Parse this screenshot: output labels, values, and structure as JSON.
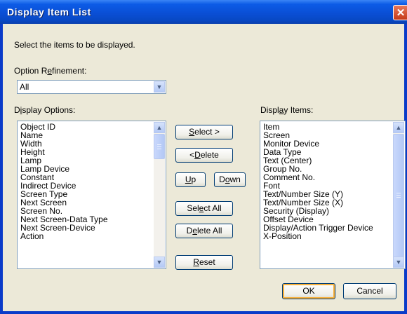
{
  "window": {
    "title": "Display Item List",
    "close_glyph": "✕"
  },
  "instructions": "Select the items to be displayed.",
  "option_refinement": {
    "label_pre": "Option R",
    "label_ul": "e",
    "label_post": "finement:",
    "value": "All"
  },
  "display_options": {
    "label_pre": "D",
    "label_ul": "i",
    "label_post": "splay Options:",
    "items": [
      "Object ID",
      "Name",
      "Width",
      "Height",
      "Lamp",
      "Lamp Device",
      "Constant",
      "Indirect Device",
      "Screen Type",
      "Next Screen",
      "Screen No.",
      "Next Screen-Data Type",
      "Next Screen-Device",
      "Action"
    ]
  },
  "display_items": {
    "label_pre": "Displ",
    "label_ul": "a",
    "label_post": "y Items:",
    "items": [
      "Item",
      "Screen",
      "Monitor Device",
      "Data Type",
      "Text (Center)",
      "Group No.",
      "Comment No.",
      "Font",
      "Text/Number Size (Y)",
      "Text/Number Size (X)",
      "Security (Display)",
      "Offset Device",
      "Display/Action Trigger Device",
      "X-Position"
    ]
  },
  "buttons": {
    "select": {
      "pre": "",
      "ul": "S",
      "post": "elect >"
    },
    "delete": {
      "pre": "< ",
      "ul": "D",
      "post": "elete"
    },
    "up": {
      "pre": "",
      "ul": "U",
      "post": "p"
    },
    "down": {
      "pre": "D",
      "ul": "o",
      "post": "wn"
    },
    "select_all": {
      "pre": "Sel",
      "ul": "e",
      "post": "ct All"
    },
    "delete_all": {
      "pre": "D",
      "ul": "e",
      "post": "lete All"
    },
    "reset": {
      "pre": "",
      "ul": "R",
      "post": "eset"
    },
    "ok": {
      "pre": "OK",
      "ul": "",
      "post": ""
    },
    "cancel": {
      "pre": "Cancel",
      "ul": "",
      "post": ""
    }
  },
  "icons": {
    "combo_arrow": "chevron-down-icon",
    "scroll_up": "chevron-up-icon",
    "scroll_down": "chevron-down-icon"
  },
  "colors": {
    "titlebar": "#0a4fd6",
    "dialog_bg": "#ece9d8",
    "close": "#c63a18",
    "default_button_ring": "#f8b03a"
  }
}
